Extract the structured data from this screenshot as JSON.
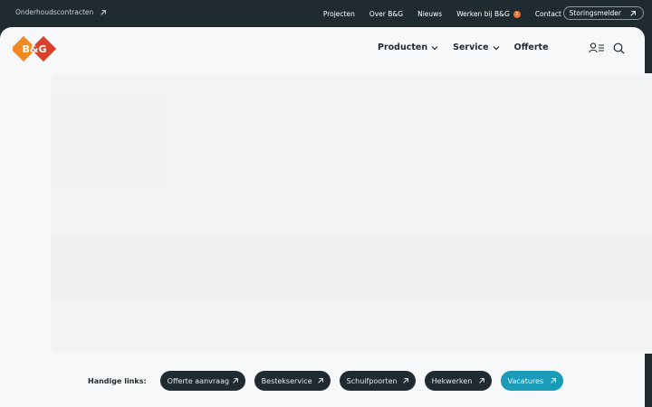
{
  "topbar": {
    "left_link": "Onderhoudscontracten",
    "nav": [
      {
        "label": "Projecten"
      },
      {
        "label": "Over B&G"
      },
      {
        "label": "Nieuws"
      },
      {
        "label": "Werken bij B&G",
        "badge": "1"
      },
      {
        "label": "Contact"
      }
    ],
    "storingsmelder": "Storingsmelder"
  },
  "header": {
    "logo_text": "B&G",
    "nav": [
      {
        "label": "Producten",
        "has_dropdown": true
      },
      {
        "label": "Service",
        "has_dropdown": true
      },
      {
        "label": "Offerte",
        "has_dropdown": false
      }
    ],
    "icons": [
      "user-menu-icon",
      "search-icon"
    ]
  },
  "quick_links": {
    "label": "Handige links:",
    "items": [
      {
        "label": "Offerte aanvraag"
      },
      {
        "label": "Bestekservice"
      },
      {
        "label": "Schuifpoorten"
      },
      {
        "label": "Hekwerken"
      },
      {
        "label": "Vacatures"
      }
    ]
  },
  "colors": {
    "dark": "#1f2a31",
    "accent": "#1a9bb8",
    "orange": "#e8752b",
    "panel": "#f7f8f9"
  }
}
